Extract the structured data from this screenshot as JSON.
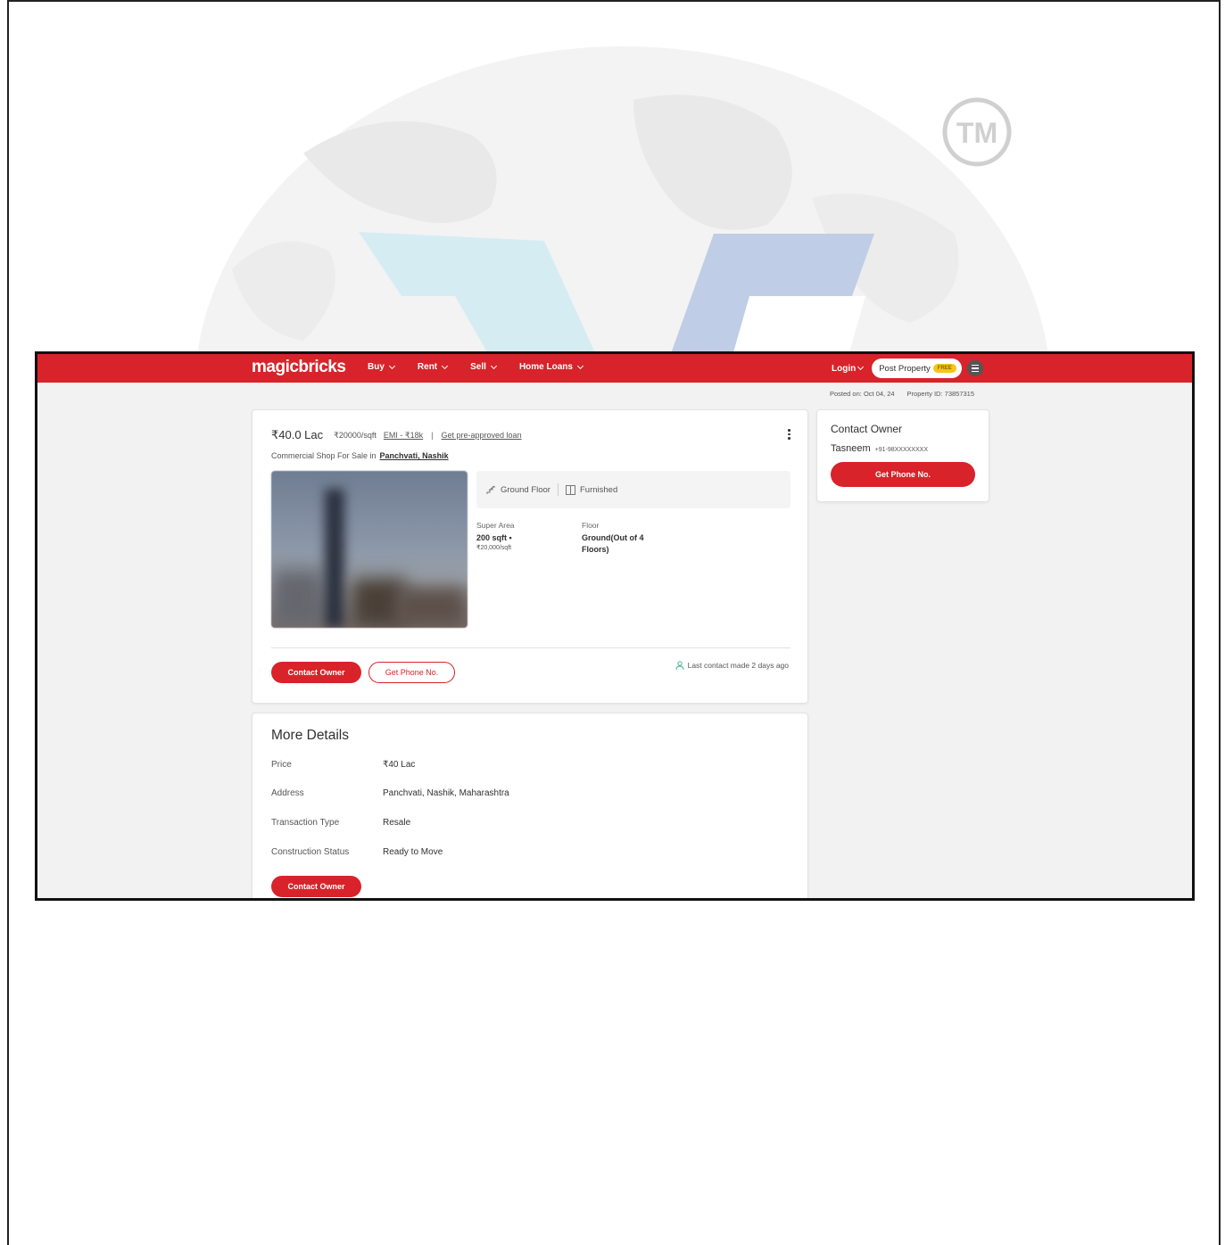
{
  "watermark": {
    "tm_text": "TM"
  },
  "navbar": {
    "logo": "magicbricks",
    "menu": [
      "Buy",
      "Rent",
      "Sell",
      "Home Loans"
    ],
    "login": "Login",
    "post_property": "Post Property",
    "free_badge": "FREE"
  },
  "meta": {
    "posted_on": "Posted on: Oct 04, 24",
    "property_id": "Property ID: 73857315"
  },
  "listing": {
    "price": "₹40.0 Lac",
    "price_per_sqft": "₹20000/sqft",
    "emi": "EMI - ₹18k",
    "loan_link": "Get pre-approved loan",
    "subtitle": "Commercial Shop For Sale in",
    "location": "Panchvati, Nashik",
    "chips": [
      "Ground Floor",
      "Furnished"
    ],
    "specs": [
      {
        "label": "Super Area",
        "value": "200 sqft •",
        "sub": "₹20,000/sqft"
      },
      {
        "label": "Floor",
        "value": "Ground(Out of 4 Floors)",
        "sub": ""
      }
    ],
    "contact_owner": "Contact Owner",
    "get_phone": "Get Phone No.",
    "last_contact": "Last contact made 2 days ago"
  },
  "side": {
    "title": "Contact Owner",
    "owner_name": "Tasneem",
    "owner_phone": "+91-98XXXXXXXX",
    "get_phone": "Get Phone No."
  },
  "more": {
    "title": "More Details",
    "rows": [
      {
        "label": "Price",
        "value": "₹40 Lac"
      },
      {
        "label": "Address",
        "value": "Panchvati, Nashik, Maharashtra"
      },
      {
        "label": "Transaction Type",
        "value": "Resale"
      },
      {
        "label": "Construction Status",
        "value": "Ready to Move"
      }
    ],
    "contact_owner": "Contact Owner"
  },
  "colors": {
    "brand_red": "#d8232a",
    "badge_yellow": "#f5c518",
    "background": "#f2f2f2"
  }
}
